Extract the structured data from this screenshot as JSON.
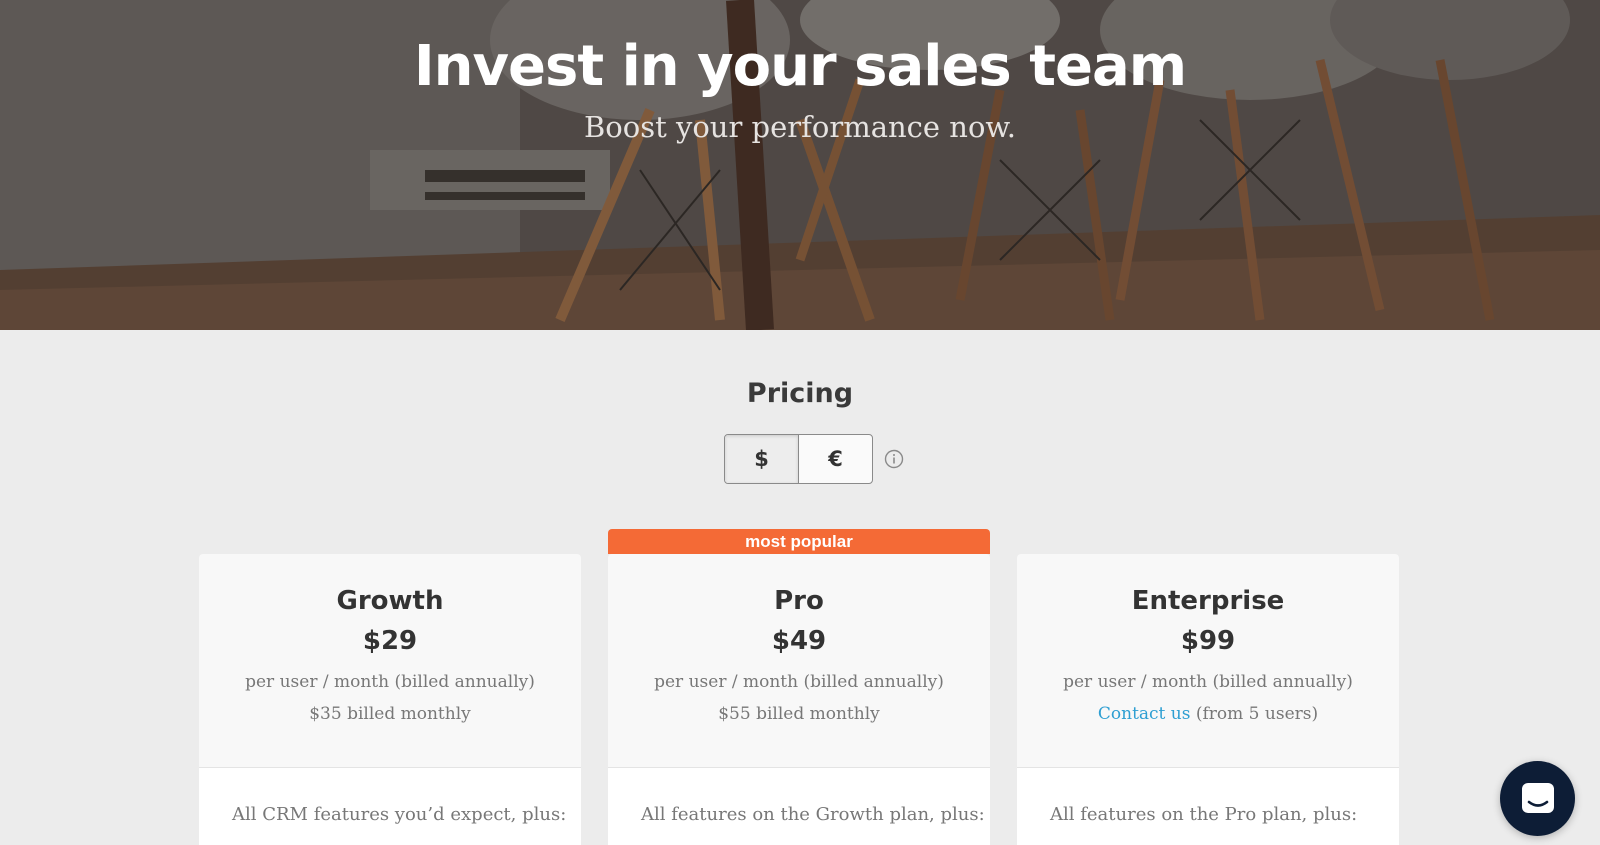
{
  "hero": {
    "title": "Invest in your sales team",
    "subtitle": "Boost your performance now."
  },
  "pricing": {
    "title": "Pricing",
    "currency_options": [
      "$",
      "€"
    ],
    "selected_currency": "$",
    "plans": [
      {
        "name": "Growth",
        "price": "$29",
        "per": "per user / month (billed annually)",
        "monthly": "$35 billed monthly",
        "features_intro": "All CRM features you’d expect, plus:"
      },
      {
        "name": "Pro",
        "badge": "most popular",
        "price": "$49",
        "per": "per user / month (billed annually)",
        "monthly": "$55 billed monthly",
        "features_intro": "All features on the Growth plan, plus:"
      },
      {
        "name": "Enterprise",
        "price": "$99",
        "per": "per user / month (billed annually)",
        "contact_link": "Contact us",
        "contact_suffix": " (from 5 users)",
        "features_intro": "All features on the Pro plan, plus:"
      }
    ]
  },
  "colors": {
    "badge": "#f46a36",
    "link": "#2e9fd2",
    "chat_button": "#0d1d36"
  },
  "icons": {
    "info": "info-circle-icon",
    "chat": "chat-icon"
  }
}
